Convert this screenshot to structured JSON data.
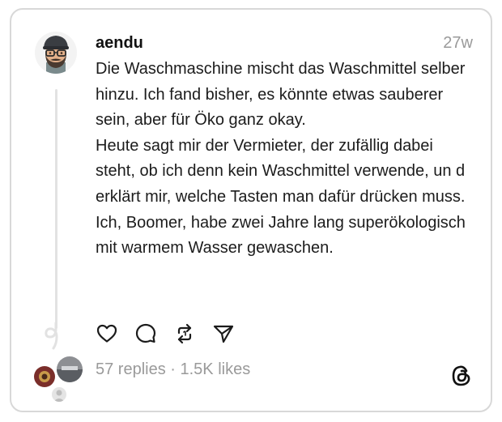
{
  "post": {
    "username": "aendu",
    "timestamp": "27w",
    "paragraphs": [
      "Die Waschmaschine mischt das Waschmittel selber hinzu. Ich fand bisher, es könnte etwas sauberer sein, aber für Öko ganz okay.",
      "Heute sagt mir der Vermieter, der zufällig dabei steht, ob ich denn kein Waschmittel verwende, un d erklärt mir, welche Tasten man dafür drücken muss.",
      "Ich, Boomer, habe zwei Jahre lang superökologisch mit warmem Wasser gewaschen."
    ]
  },
  "stats": {
    "text": "57 replies · 1.5K likes"
  },
  "icons": {
    "like": "heart-icon",
    "reply": "speech-bubble-icon",
    "repost": "repost-arrows-icon",
    "share": "paper-plane-icon",
    "brand": "threads-logo-icon"
  },
  "colors": {
    "text": "#1c1c1c",
    "muted": "#9a9a9a",
    "border": "#d8d8d8"
  }
}
